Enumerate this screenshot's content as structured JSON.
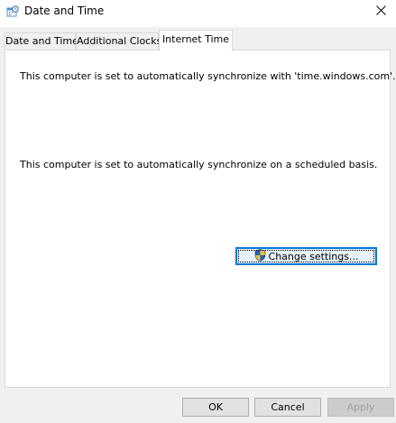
{
  "window": {
    "title": "Date and Time",
    "icons": {
      "app": "date-time-icon",
      "close": "close-icon"
    }
  },
  "tabs": [
    {
      "label": "Date and Time",
      "selected": false
    },
    {
      "label": "Additional Clocks",
      "selected": false
    },
    {
      "label": "Internet Time",
      "selected": true
    }
  ],
  "internet_time": {
    "server_message": "This computer is set to automatically synchronize with 'time.windows.com'.",
    "schedule_message": "This computer is set to automatically synchronize on a scheduled basis.",
    "change_settings_label": "Change settings...",
    "change_settings_icon": "uac-shield-icon"
  },
  "buttons": {
    "ok": "OK",
    "cancel": "Cancel",
    "apply": "Apply",
    "apply_enabled": false
  },
  "colors": {
    "accent": "#0078d7",
    "shield_blue": "#1f5fbf",
    "shield_yellow": "#f2c02c"
  }
}
